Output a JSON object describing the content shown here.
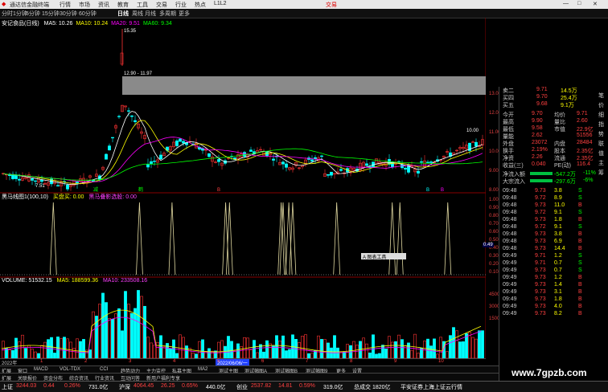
{
  "app": {
    "title": "通达信金融终端",
    "account_label": "交易",
    "win_controls": [
      "—",
      "□",
      "✕"
    ]
  },
  "menu": [
    "行情",
    "市场",
    "资讯",
    "教育",
    "工具",
    "交易",
    "行业",
    "热点",
    "L1L2"
  ],
  "periods": [
    "分时",
    "1分钟",
    "5分钟",
    "15分钟",
    "30分钟",
    "60分钟",
    "日线",
    "周线",
    "月线",
    "多周期",
    "更多"
  ],
  "active_period_index": 6,
  "kline": {
    "title": "安记食品(日线)",
    "ma": [
      {
        "label": "MA5: 10.26",
        "color": "#ffffff"
      },
      {
        "label": "MA10: 10.24",
        "color": "#ffff00"
      },
      {
        "label": "MA20: 9.51",
        "color": "#ff00ff"
      },
      {
        "label": "MA60: 9.34",
        "color": "#00ff00"
      }
    ],
    "annotations": {
      "high": "15.35",
      "low": "7.51",
      "range_box": "12.90 - 11.97",
      "cur": "10.00"
    },
    "markers": [
      "减",
      "鹤",
      "B"
    ],
    "right_axis": [
      "13.00",
      "12.00",
      "11.00",
      "10.00",
      "9.00",
      "8.00"
    ]
  },
  "indicator": {
    "title": "黑马线图1(100,10)",
    "label_a": "买盘买: 0.00",
    "label_b": "黑马叠影选股: 0.00",
    "tooltip": "A 图表工具",
    "left_val": "0.49",
    "right_axis": [
      "1.00",
      "0.90",
      "0.80",
      "0.70",
      "0.60",
      "0.50",
      "0.40",
      "0.30",
      "0.20",
      "0.10"
    ],
    "chart_data": {
      "type": "line",
      "x_index": [
        27,
        72,
        89,
        117,
        119,
        146,
        147,
        150,
        152,
        175,
        204,
        208,
        233
      ],
      "values": [
        1,
        1,
        1,
        1,
        1,
        1,
        1,
        1,
        1,
        1,
        1,
        1,
        1
      ],
      "ylim": [
        0,
        1
      ]
    }
  },
  "volume": {
    "title": "VOLUME: 51532.15",
    "ma5": "MA5: 188599.36",
    "ma10": "MA10: 233508.16",
    "right_axis": [
      "45000",
      "30000",
      "15000"
    ],
    "date_marker": "2022/06/06/一",
    "year_left": "2022年",
    "months": [
      "1",
      "2",
      "3",
      "4",
      "5",
      "6",
      "7",
      "8",
      "9",
      "10"
    ]
  },
  "bottom_tabs": [
    "扩展",
    "窗口",
    "MACD",
    "VOL-TDX",
    "CCI",
    "趋势动力",
    "主力监控",
    "私募主图",
    "MA2",
    "测试主图",
    "测试幅图A",
    "测试幅图B",
    "测试幅图9",
    "更多",
    "设置"
  ],
  "bottom_tabs2": [
    "扩展",
    "关联报价",
    "资金分布",
    "综合资讯",
    "行业资讯",
    "互动问答",
    "新用户福利专享"
  ],
  "quote": {
    "sell_rows": [
      {
        "label": "卖二",
        "price": "9.71",
        "vol": "14.5万"
      },
      {
        "label": "买四",
        "price": "9.70",
        "vol": "25.4万"
      },
      {
        "label": "买五",
        "price": "9.68",
        "vol": "9.1万"
      }
    ],
    "rows": [
      {
        "l1": "今开",
        "v1": "9.70",
        "l2": "均价",
        "v2": "9.71"
      },
      {
        "l1": "最高",
        "v1": "9.90",
        "l2": "量比",
        "v2": "2.60"
      },
      {
        "l1": "最低",
        "v1": "9.58",
        "l2": "市值",
        "v2": "22.9亿"
      },
      {
        "l1": "量能",
        "v1": "2.62",
        "l2": "",
        "v2": "51556"
      },
      {
        "l1": "外盘",
        "v1": "23072",
        "l2": "内盘",
        "v2": "28484"
      },
      {
        "l1": "换手",
        "v1": "2.19%",
        "l2": "股本",
        "v2": "2.35亿"
      },
      {
        "l1": "净资",
        "v1": "2.26",
        "l2": "流通",
        "v2": "2.35亿"
      },
      {
        "l1": "收益(三)",
        "v1": "0.040",
        "l2": "PE(动)",
        "v2": "116.4"
      }
    ],
    "flows": [
      {
        "label": "净流入额",
        "value": "-547.2万",
        "pct": "-11%"
      },
      {
        "label": "大宗流入",
        "value": "-297.6万",
        "pct": "-6%"
      }
    ],
    "ticks": [
      {
        "t": "09:48",
        "p": "9.73",
        "v": "3.8",
        "s": "S"
      },
      {
        "t": "09:48",
        "p": "9.72",
        "v": "8.9",
        "s": "S"
      },
      {
        "t": "09:48",
        "p": "9.73",
        "v": "11.0",
        "s": "B"
      },
      {
        "t": "09:48",
        "p": "9.72",
        "v": "9.1",
        "s": "S"
      },
      {
        "t": "09:48",
        "p": "9.73",
        "v": "1.8",
        "s": "B"
      },
      {
        "t": "09:48",
        "p": "9.72",
        "v": "9.1",
        "s": "S"
      },
      {
        "t": "09:48",
        "p": "9.73",
        "v": "3.8",
        "s": "B"
      },
      {
        "t": "09:48",
        "p": "9.73",
        "v": "6.9",
        "s": "B"
      },
      {
        "t": "09:48",
        "p": "9.73",
        "v": "14.4",
        "s": "B"
      },
      {
        "t": "09:49",
        "p": "9.71",
        "v": "1.2",
        "s": "S"
      },
      {
        "t": "09:49",
        "p": "9.71",
        "v": "0.7",
        "s": "S"
      },
      {
        "t": "09:49",
        "p": "9.73",
        "v": "0.7",
        "s": "S"
      },
      {
        "t": "09:49",
        "p": "9.73",
        "v": "1.2",
        "s": "B"
      },
      {
        "t": "09:49",
        "p": "9.73",
        "v": "1.4",
        "s": "B"
      },
      {
        "t": "09:49",
        "p": "9.73",
        "v": "3.1",
        "s": "B"
      },
      {
        "t": "09:49",
        "p": "9.73",
        "v": "1.8",
        "s": "B"
      },
      {
        "t": "09:49",
        "p": "9.73",
        "v": "4.0",
        "s": "B"
      },
      {
        "t": "09:49",
        "p": "9.73",
        "v": "8.2",
        "s": "B"
      }
    ],
    "tabs": [
      "笔",
      "价",
      "细",
      "指",
      "势",
      "联",
      "值",
      "主",
      "筹"
    ],
    "bottom_links": [
      "普通",
      "图文F10",
      "相关"
    ]
  },
  "status": {
    "items": [
      {
        "name": "上证",
        "val": "3244.03",
        "chg": "0.44",
        "pct": "0.26%",
        "amt": "731.0亿"
      },
      {
        "name": "沪深",
        "val": "4064.45",
        "chg": "26.25",
        "pct": "0.65%",
        "amt": "440.0亿"
      },
      {
        "name": "创业",
        "val": "2537.82",
        "chg": "14.81",
        "pct": "0.59%",
        "amt": "319.0亿"
      }
    ],
    "extra": "总成交 1820亿",
    "news": "平安证券上海上证云行情"
  },
  "watermark": "www.7gpzb.com",
  "colors": {
    "up": "#ff3333",
    "down": "#00ffff",
    "ma5": "#ffffff",
    "ma10": "#ffff00",
    "ma20": "#ff00ff",
    "ma60": "#00ff00",
    "signal": "#e0d8a0"
  }
}
